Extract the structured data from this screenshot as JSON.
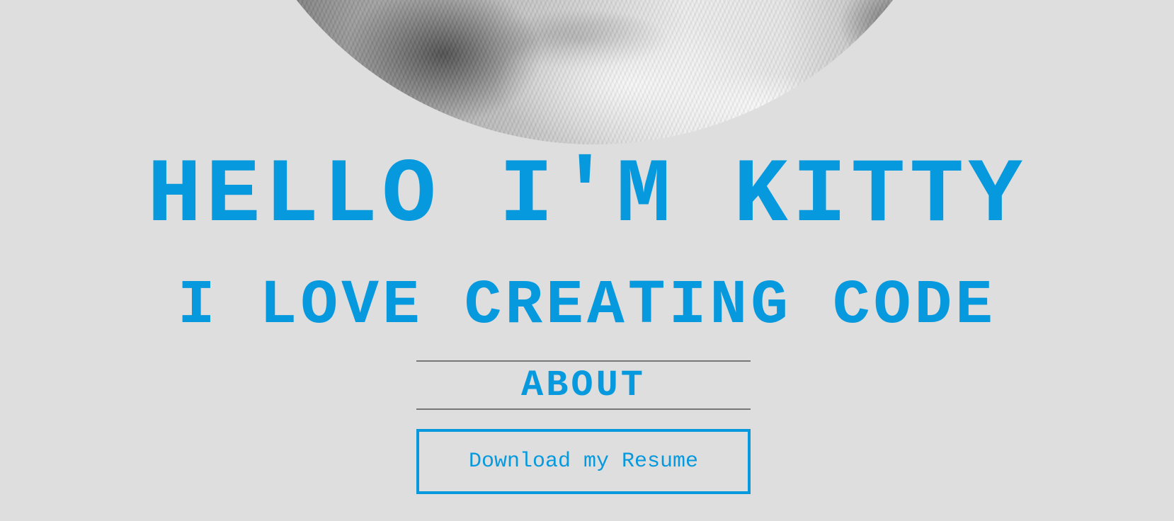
{
  "hero": {
    "title": "HELLO I'M KITTY",
    "subtitle": "I LOVE CREATING CODE"
  },
  "nav": {
    "about_label": "ABOUT"
  },
  "actions": {
    "resume_label": "Download my Resume"
  },
  "colors": {
    "accent": "#0799dd",
    "background": "#dedede",
    "divider": "#777777"
  }
}
